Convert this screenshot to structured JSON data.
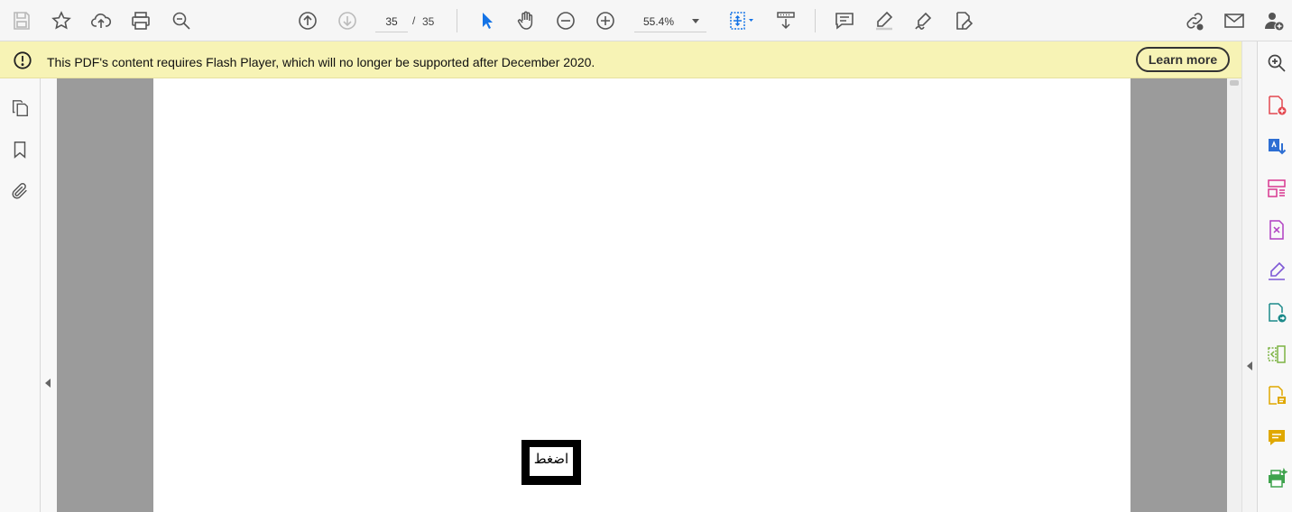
{
  "toolbar": {
    "page_current": "35",
    "page_separator": "/",
    "page_total": "35",
    "zoom_value": "55.4%"
  },
  "banner": {
    "message": "This PDF's content requires Flash Player, which will no longer be supported after December 2020.",
    "learn_more_label": "Learn more"
  },
  "document": {
    "press_button_label": "اضغط"
  },
  "colors": {
    "banner_bg": "#f7f3b5",
    "doc_bg": "#9b9b9b",
    "accent_blue": "#1473e6"
  }
}
